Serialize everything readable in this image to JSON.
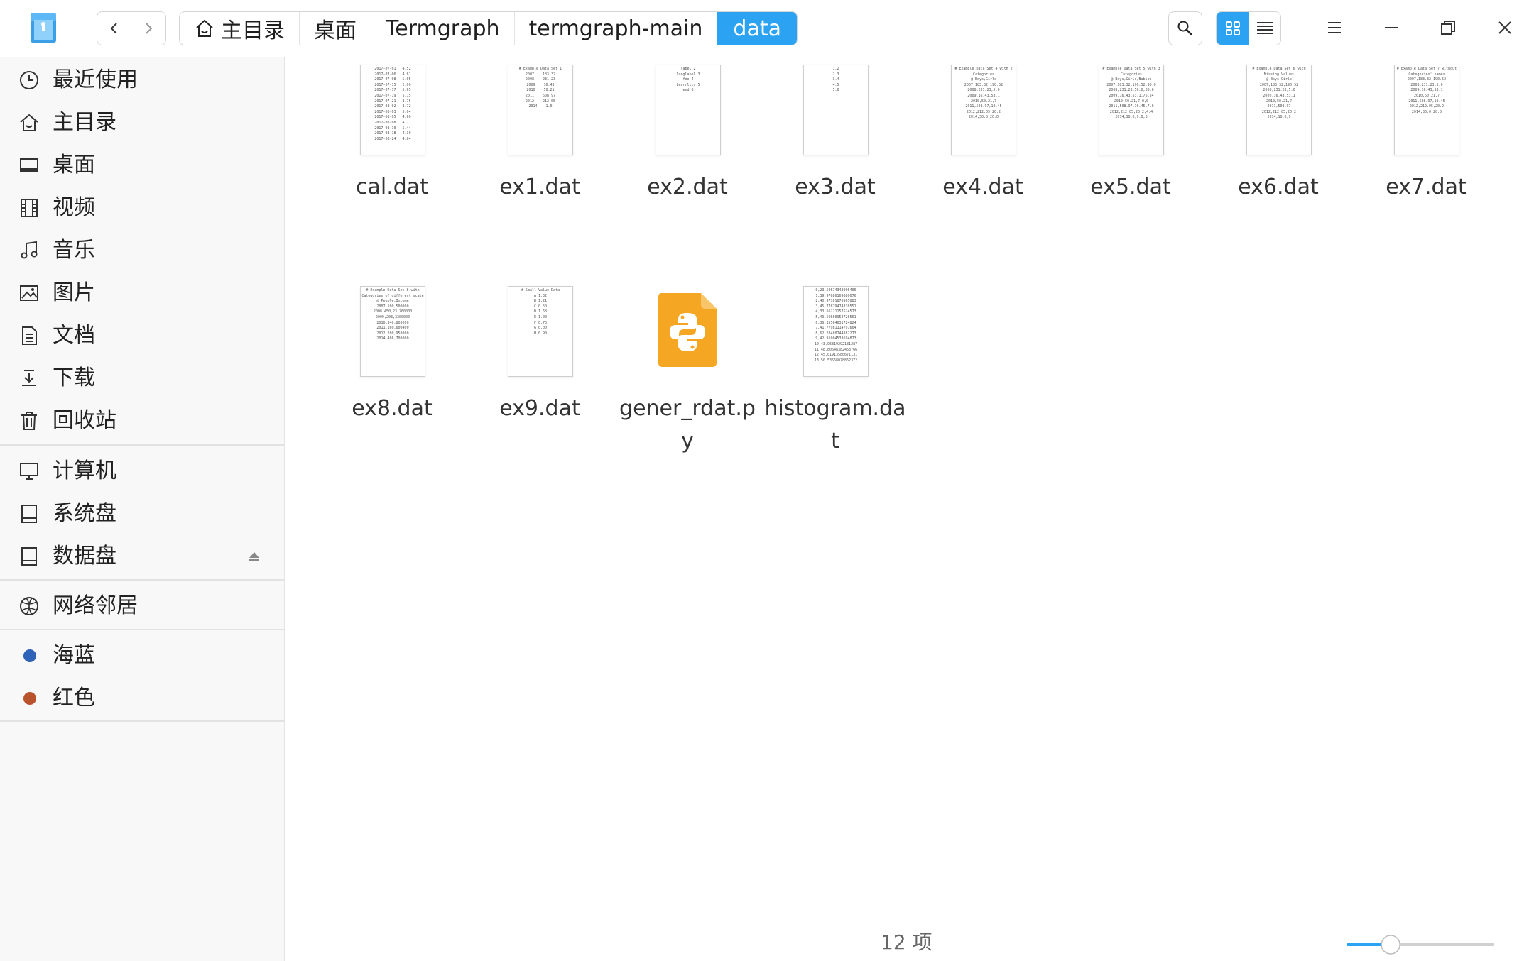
{
  "breadcrumb": [
    "主目录",
    "桌面",
    "Termgraph",
    "termgraph-main",
    "data"
  ],
  "sidebar": {
    "places": [
      {
        "label": "最近使用",
        "icon": "clock-icon"
      },
      {
        "label": "主目录",
        "icon": "home-icon"
      },
      {
        "label": "桌面",
        "icon": "desktop-icon"
      },
      {
        "label": "视频",
        "icon": "film-icon"
      },
      {
        "label": "音乐",
        "icon": "music-icon"
      },
      {
        "label": "图片",
        "icon": "picture-icon"
      },
      {
        "label": "文档",
        "icon": "document-icon"
      },
      {
        "label": "下载",
        "icon": "download-icon"
      },
      {
        "label": "回收站",
        "icon": "trash-icon"
      }
    ],
    "devices": [
      {
        "label": "计算机",
        "icon": "computer-icon"
      },
      {
        "label": "系统盘",
        "icon": "disk-icon"
      },
      {
        "label": "数据盘",
        "icon": "disk-icon"
      }
    ],
    "network": [
      {
        "label": "网络邻居",
        "icon": "network-icon"
      }
    ],
    "tags": [
      {
        "label": "海蓝",
        "color": "#2e63b8"
      },
      {
        "label": "红色",
        "color": "#b8532e"
      }
    ]
  },
  "files": [
    {
      "name": "cal.dat",
      "kind": "text",
      "preview": "2017-07-01   4.52\n2017-07-06   4.81\n2017-07-08   5.05\n2017-07-15   2.00\n2017-07-17   5.65\n2017-07-19   5.15\n2017-07-21   3.75\n2017-08-02   3.72\n2017-08-03   5.04\n2017-08-05   4.60\n2017-08-08   4.77\n2017-08-10   5.44\n2017-08-18   4.30\n2017-08-24   4.84"
    },
    {
      "name": "ex1.dat",
      "kind": "text",
      "preview": "# Example Data Set 1\n2007    183.32\n2008    231.23\n2009    16.43\n2010    50.21\n2011    508.97\n2012    212.05\n2014    1.0"
    },
    {
      "name": "ex2.dat",
      "kind": "text",
      "preview": "label 2\nlonglabel 3\nfoo 4\nbarrrllls 5\nend 6"
    },
    {
      "name": "ex3.dat",
      "kind": "text",
      "preview": "1.2\n2.3\n3.4\n4.5\n5.6"
    },
    {
      "name": "ex4.dat",
      "kind": "text",
      "preview": "# Example Data Set 4 with 2\nCategories\n@ Boys,Girls\n2007,183.32,190.52\n2008,231.23,5.0\n2009,16.43,53.1\n2010,50.21,7\n2011,508.97,10.45\n2012,212.05,20.2\n2014,30.0,20.0"
    },
    {
      "name": "ex5.dat",
      "kind": "text",
      "preview": "# Example Data Set 5 with 3\nCategories\n@ Boys,Girls,Babies\n2007,183.32,190.52,90.0\n2008,231.23,50.0,80.6\n2009,16.43,53.1,76.54\n2010,50.21,7.0,0\n2011,508.97,10.45,7.0\n2012,212.05,20.2,4.4\n2014,30.0,9.0,8"
    },
    {
      "name": "ex6.dat",
      "kind": "text",
      "preview": "# Example Data Set 6 with\nMissing Values\n@ Boys,Girls\n2007,183.32,190.52\n2008,231.23,5.0\n2009,16.43,53.1\n2010,50.21,7\n2011,508.97\n2012,212.05,20.2\n2014,10.0,9"
    },
    {
      "name": "ex7.dat",
      "kind": "text",
      "preview": "# Example Data Set 7 without\nCategories' names\n2007,183.32,190.52\n2008,231.23,5.0\n2009,16.43,53.1\n2010,50.21,7\n2011,508.97,10.45\n2012,212.05,20.2\n2014,30.0,20.0"
    },
    {
      "name": "ex8.dat",
      "kind": "text",
      "preview": "# Example Data Set 8 with\nCategories of different scale\n@ People,Income\n2007,100,500000\n2008,450,23,760000\n2009,203,3300000\n2010,340,800000\n2011,160,600400\n2012,200,950000\n2014,486,700000"
    },
    {
      "name": "ex9.dat",
      "kind": "text",
      "preview": "# Small Value Data\nA 1.32\nB 1.21\nC 0.50\nD 1.68\nE 1.00\nF 0.75\nG 0.00\nH 0.90"
    },
    {
      "name": "gener_rdat.py",
      "kind": "python",
      "preview": ""
    },
    {
      "name": "histogram.dat",
      "kind": "text",
      "preview": "0,23.50674348906406\n1,39.97686169880076\n2,40.97161876965883\n3,45.77879474330551\n4,33.66221157524573\n5,49.59660952726561\n6,36.35564631724824\n7,41.77981114791604\n8,62.28480744882273\n9,42.91004533694873\n10,43.96319292181287\n11,48.80648382458766\n12,45.01913580671131\n13,50.53668078862372"
    }
  ],
  "status": {
    "count_text": "12 项"
  },
  "zoom": {
    "level": 0.27
  }
}
